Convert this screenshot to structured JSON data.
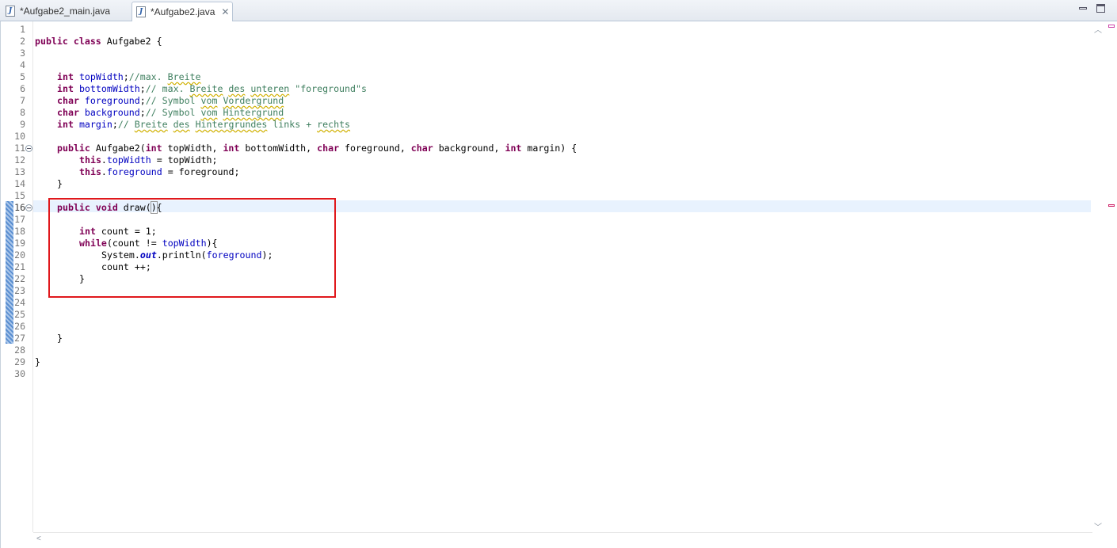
{
  "tabs": [
    {
      "label": "*Aufgabe2_main.java",
      "icon": "java-file-icon"
    },
    {
      "label": "*Aufgabe2.java",
      "icon": "java-file-icon",
      "close": "✕"
    }
  ],
  "editor": {
    "line_numbers": [
      "1",
      "2",
      "3",
      "4",
      "5",
      "6",
      "7",
      "8",
      "9",
      "10",
      "11",
      "12",
      "13",
      "14",
      "15",
      "16",
      "17",
      "18",
      "19",
      "20",
      "21",
      "22",
      "23",
      "24",
      "25",
      "26",
      "27",
      "28",
      "29",
      "30"
    ],
    "fold_lines": [
      11,
      16
    ],
    "current_line": 16,
    "code": {
      "l2": {
        "a": "public",
        "b": "class",
        "c": " Aufgabe2 {"
      },
      "l5": {
        "kw": "int",
        "f": "topWidth",
        "p": ";",
        "c1": "//max. ",
        "c2": "Breite"
      },
      "l6": {
        "kw": "int",
        "f": "bottomWidth",
        "p": ";",
        "c1": "// max. ",
        "c2": "Breite",
        "c3": " ",
        "c4": "des",
        "c5": " ",
        "c6": "unteren",
        "c7": " \"foreground\"s"
      },
      "l7": {
        "kw": "char",
        "f": "foreground",
        "p": ";",
        "c1": "// Symbol ",
        "c2": "vom",
        "c3": " ",
        "c4": "Vordergrund"
      },
      "l8": {
        "kw": "char",
        "f": "background",
        "p": ";",
        "c1": "// Symbol ",
        "c2": "vom",
        "c3": " ",
        "c4": "Hintergrund"
      },
      "l9": {
        "kw": "int",
        "f": "margin",
        "p": ";",
        "c1": "// ",
        "c2": "Breite",
        "c3": " ",
        "c4": "des",
        "c5": " ",
        "c6": "Hintergrundes",
        "c7": " links + ",
        "c8": "rechts"
      },
      "l11": {
        "k1": "public",
        "t1": " Aufgabe2(",
        "k2": "int",
        "t2": " topWidth, ",
        "k3": "int",
        "t3": " bottomWidth, ",
        "k4": "char",
        "t4": " foreground, ",
        "k5": "char",
        "t5": " background, ",
        "k6": "int",
        "t6": " margin) {"
      },
      "l12": {
        "k": "this",
        "d": ".",
        "f": "topWidth",
        "t": " = topWidth;"
      },
      "l13": {
        "k": "this",
        "d": ".",
        "f": "foreground",
        "t": " = foreground;"
      },
      "l14": {
        "t": "}"
      },
      "l16": {
        "k1": "public",
        "k2": "void",
        "t": " draw(",
        "p": ")",
        "b": "{"
      },
      "l18": {
        "k": "int",
        "t": " count = 1;"
      },
      "l19": {
        "k": "while",
        "t": "(count != ",
        "f": "topWidth",
        "e": "){"
      },
      "l20": {
        "t1": "System.",
        "o": "out",
        "t2": ".println(",
        "f": "foreground",
        "t3": ");"
      },
      "l21": {
        "t": "count ++;"
      },
      "l22": {
        "t": "}"
      },
      "l27": {
        "t": "}"
      },
      "l29": {
        "t": "}"
      }
    }
  },
  "colors": {
    "keyword": "#7f0055",
    "field": "#0000c0",
    "comment": "#3f7f5f",
    "highlight_box": "#e0181c",
    "current_line": "#e8f2fe"
  }
}
